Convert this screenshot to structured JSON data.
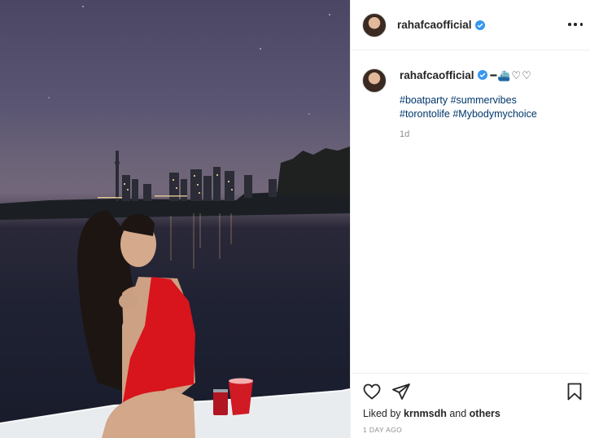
{
  "post": {
    "username": "rahafcaofficial",
    "verified": true,
    "caption": "━⛴️♡♡",
    "hashtags": [
      "#boatparty",
      "#summervibes",
      "#torontolife",
      "#Mybodymychoice"
    ],
    "relative_time": "1d",
    "liked_by_prefix": "Liked by",
    "liked_by_user": "krnmsdh",
    "liked_by_and": "and",
    "liked_by_others": "others",
    "date": "1 DAY AGO"
  },
  "icons": {
    "verified": "verified-badge-icon",
    "more": "more-options-icon",
    "like": "heart-icon",
    "share": "paper-plane-icon",
    "save": "bookmark-icon"
  },
  "colors": {
    "verified_blue": "#3897f0",
    "hashtag_link": "#00376b",
    "muted": "#8e8e8e",
    "swimsuit": "#d8141c"
  }
}
